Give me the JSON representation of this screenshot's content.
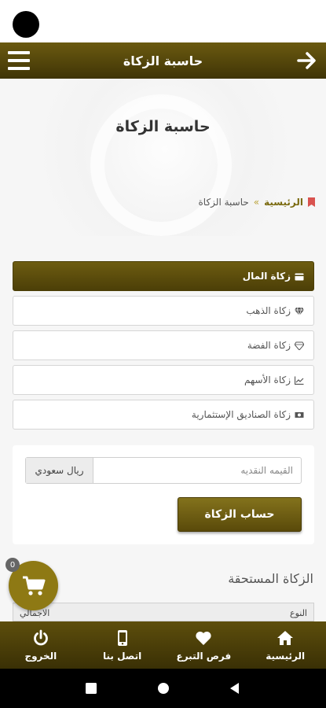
{
  "app_bar": {
    "title": "حاسبة الزكاة"
  },
  "hero": {
    "title": "حاسبة الزكاة"
  },
  "breadcrumb": {
    "home": "الرئيسية",
    "separator": "»",
    "current": "حاسبة الزكاة"
  },
  "tabs": [
    {
      "label": "زكاة المال",
      "icon": "wallet-icon",
      "active": true
    },
    {
      "label": "زكاة الذهب",
      "icon": "gem-icon",
      "active": false
    },
    {
      "label": "زكاة الفضة",
      "icon": "diamond-icon",
      "active": false
    },
    {
      "label": "زكاة الأسهم",
      "icon": "chart-icon",
      "active": false
    },
    {
      "label": "زكاة الصناديق الإستثمارية",
      "icon": "money-icon",
      "active": false
    }
  ],
  "calculator": {
    "amount_placeholder": "القيمه النقديه",
    "amount_value": "",
    "currency": "ريال سعودي",
    "calculate_label": "حساب الزكاة"
  },
  "due": {
    "title": "الزكاة المستحقة",
    "col_type": "النوع",
    "col_total": "الاجمالي"
  },
  "cart": {
    "count": "0"
  },
  "bottom_nav": [
    {
      "label": "الرئيسية",
      "icon": "home-icon"
    },
    {
      "label": "فرص التبرع",
      "icon": "heart-icon"
    },
    {
      "label": "اتصل بنا",
      "icon": "phone-icon"
    },
    {
      "label": "الخروج",
      "icon": "power-icon"
    }
  ],
  "colors": {
    "primary": "#5d4e0c",
    "accent": "#8e7914",
    "breadcrumb_icon": "#d9534f"
  }
}
